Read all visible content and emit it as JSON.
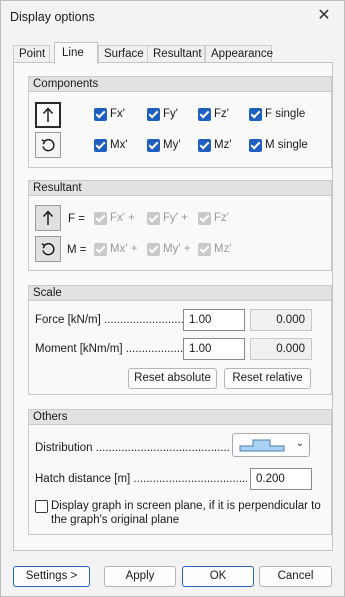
{
  "window": {
    "title": "Display options"
  },
  "tabs": [
    "Point",
    "Line",
    "Surface",
    "Resultant",
    "Appearance"
  ],
  "components": {
    "title": "Components",
    "row1": [
      "Fx'",
      "Fy'",
      "Fz'",
      "F single"
    ],
    "row2": [
      "Mx'",
      "My'",
      "Mz'",
      "M single"
    ]
  },
  "resultant": {
    "title": "Resultant",
    "f_label": "F =",
    "m_label": "M =",
    "f_terms": [
      "Fx' +",
      "Fy' +",
      "Fz'"
    ],
    "m_terms": [
      "Mx' +",
      "My' +",
      "Mz'"
    ]
  },
  "scale": {
    "title": "Scale",
    "force_label": "Force [kN/m] ...............................",
    "moment_label": "Moment [kNm/m] ...............................",
    "force_value": "1.00",
    "force_abs": "0.000",
    "moment_value": "1.00",
    "moment_abs": "0.000",
    "reset_absolute": "Reset absolute",
    "reset_relative": "Reset relative"
  },
  "others": {
    "title": "Others",
    "distribution_label": "Distribution ................................................",
    "hatch_label": "Hatch distance [m] ...............................................",
    "hatch_value": "0.200",
    "graph_line1": "Display graph in screen plane, if it is perpendicular to",
    "graph_line2": "the graph's original plane"
  },
  "buttons": {
    "settings": "Settings >",
    "apply": "Apply",
    "ok": "OK",
    "cancel": "Cancel"
  },
  "colors": {
    "accent": "#1f5fbf",
    "disabled": "#c9c9c9"
  }
}
